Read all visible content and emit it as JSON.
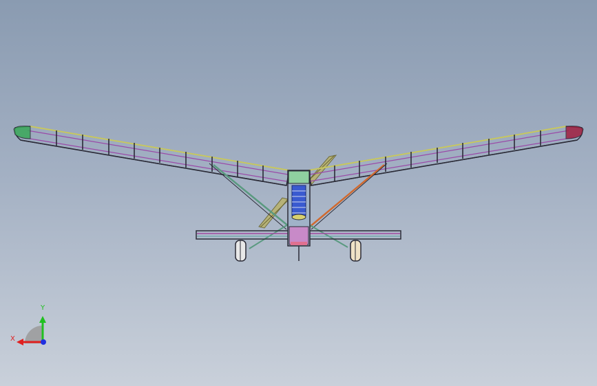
{
  "view": {
    "background_top": "#8a9bb1",
    "background_bottom": "#c9d0da"
  },
  "model": {
    "subject": "ultralight-aircraft-frame",
    "colors": {
      "frame": "#2a2a36",
      "wing_edge_yellow": "#c8c860",
      "wing_edge_purple": "#9a4aa8",
      "wingtip_left": "#3aa85a",
      "wingtip_right": "#a02040",
      "propeller": "#b8b270",
      "strut_green": "#5a9a80",
      "strut_orange": "#d06a30",
      "fuselage_blue": "#3a5ad0",
      "tail_magenta": "#a04aa0",
      "wheel": "#e8e8e8"
    }
  },
  "triad": {
    "x_label": "X",
    "y_label": "Y",
    "x_color": "#e02020",
    "y_color": "#20c020",
    "z_color": "#2030e0"
  }
}
